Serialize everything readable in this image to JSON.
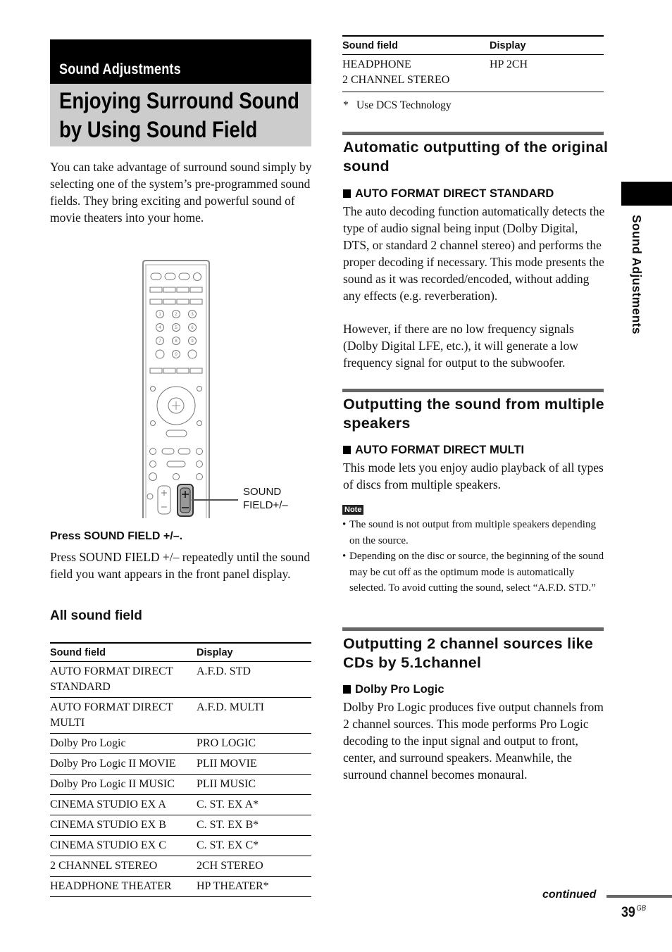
{
  "header": {
    "section": "Sound Adjustments",
    "title_lines": [
      "Enjoying Surround Sound",
      "by Using Sound Field"
    ]
  },
  "intro": "You can take advantage of surround sound simply by selecting one of the system’s pre-programmed sound fields. They bring exciting and powerful sound of movie theaters into your home.",
  "illustration": {
    "callout_lines": [
      "SOUND",
      "FIELD+/–"
    ],
    "number_keys": [
      "1",
      "2",
      "3",
      "4",
      "5",
      "6",
      "7",
      "8",
      "9",
      "0"
    ]
  },
  "step": {
    "heading": "Press SOUND FIELD +/–.",
    "body": "Press SOUND FIELD +/– repeatedly until the sound field you want appears in the front panel display."
  },
  "all_sound_field": {
    "heading": "All sound field",
    "columns": [
      "Sound field",
      "Display"
    ],
    "rows": [
      [
        "AUTO FORMAT DIRECT STANDARD",
        "A.F.D. STD"
      ],
      [
        "AUTO FORMAT DIRECT MULTI",
        "A.F.D. MULTI"
      ],
      [
        "Dolby Pro Logic",
        "PRO LOGIC"
      ],
      [
        "Dolby Pro Logic II MOVIE",
        "PLII MOVIE"
      ],
      [
        "Dolby Pro Logic II MUSIC",
        "PLII MUSIC"
      ],
      [
        "CINEMA STUDIO EX A",
        "C. ST. EX A*"
      ],
      [
        "CINEMA STUDIO EX B",
        "C. ST. EX B*"
      ],
      [
        "CINEMA STUDIO EX C",
        "C. ST. EX C*"
      ],
      [
        "2 CHANNEL STEREO",
        "2CH STEREO"
      ],
      [
        "HEADPHONE THEATER",
        "HP THEATER*"
      ]
    ],
    "continued_columns": [
      "Sound field",
      "Display"
    ],
    "continued_rows": [
      [
        "HEADPHONE 2 CHANNEL STEREO",
        "HP 2CH"
      ]
    ],
    "footnote_mark": "*",
    "footnote": "Use DCS Technology"
  },
  "sections": [
    {
      "heading": "Automatic outputting of the original sound",
      "subheading": "AUTO FORMAT DIRECT STANDARD",
      "paragraphs": [
        "The auto decoding function automatically detects the type of audio signal being input (Dolby Digital, DTS, or standard 2 channel stereo) and performs the proper decoding if necessary. This mode presents the sound as it was recorded/encoded, without adding any effects (e.g. reverberation).",
        "However, if there are no low frequency signals (Dolby Digital LFE, etc.), it will generate a low frequency signal for output to the subwoofer."
      ]
    },
    {
      "heading": "Outputting the sound from multiple speakers",
      "subheading": "AUTO FORMAT DIRECT MULTI",
      "paragraphs": [
        "This mode lets you enjoy audio playback of all types of discs from multiple speakers."
      ]
    },
    {
      "heading": "Outputting 2 channel sources like CDs by 5.1channel",
      "subheading": "Dolby Pro Logic",
      "paragraphs": [
        "Dolby Pro Logic produces five output channels from 2 channel sources. This mode performs Pro Logic decoding to the input signal and output to front, center, and surround speakers. Meanwhile, the surround channel becomes monaural."
      ]
    }
  ],
  "note": {
    "label": "Note",
    "items": [
      "The sound is not output from multiple speakers depending on the source.",
      "Depending on the disc or source, the beginning of the sound may be cut off as the optimum mode is automatically selected. To avoid cutting the sound, select “A.F.D. STD.”"
    ]
  },
  "side_tab": {
    "label": "Sound Adjustments"
  },
  "footer": {
    "continued": "continued",
    "page_number": "39",
    "page_suffix": "GB"
  }
}
